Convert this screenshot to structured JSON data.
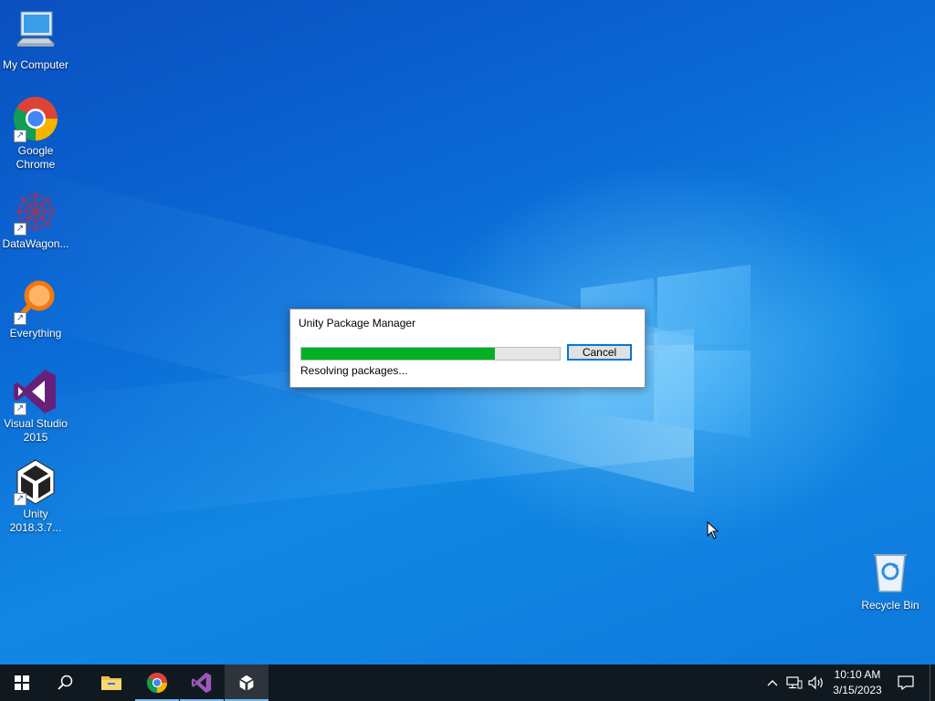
{
  "desktop": {
    "icons": [
      {
        "label": "My Computer",
        "icon": "monitor-icon"
      },
      {
        "label": "Google Chrome",
        "icon": "chrome-icon"
      },
      {
        "label": "DataWagon...",
        "icon": "datawagon-icon"
      },
      {
        "label": "Everything",
        "icon": "search-magnifier-icon"
      },
      {
        "label": "Visual Studio 2015",
        "icon": "visual-studio-icon"
      },
      {
        "label": "Unity 2018.3.7...",
        "icon": "unity-icon"
      },
      {
        "label": "Recycle Bin",
        "icon": "recycle-bin-icon"
      }
    ]
  },
  "dialog": {
    "title": "Unity Package Manager",
    "progress": 0.75,
    "status": "Resolving packages...",
    "cancel_label": "Cancel"
  },
  "taskbar": {
    "clock_time": "10:10 AM",
    "clock_date": "3/15/2023",
    "apps": [
      "start",
      "search",
      "file-explorer",
      "chrome",
      "visual-studio",
      "unity"
    ],
    "active_app": "unity"
  },
  "colors": {
    "progress_fill": "#06b025",
    "button_focus": "#0078d7",
    "taskbar_bg": "#101820"
  }
}
